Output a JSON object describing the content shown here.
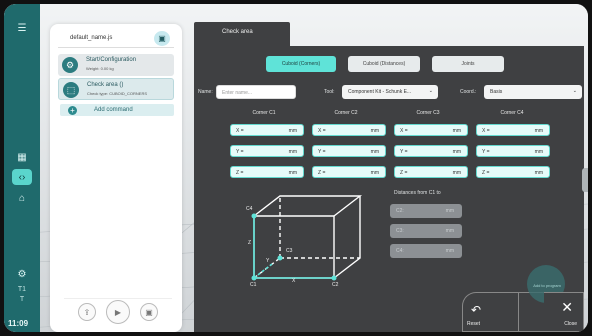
{
  "sidebar": {
    "time": "11:09",
    "small_labels": [
      "T1",
      "T"
    ]
  },
  "program": {
    "file_name": "default_name.js",
    "commands": [
      {
        "title": "Start/Configuration",
        "subtitle": "Weight: 0.00 kg"
      },
      {
        "title": "Check area ()",
        "subtitle": "Check type: CUBOID_CORNERS"
      }
    ],
    "add_command": "Add command"
  },
  "dialog": {
    "tab": "Check area",
    "segments": [
      "Cuboid (Corners)",
      "Cuboid (Distances)",
      "Joints"
    ],
    "name_label": "Name:",
    "name_placeholder": "Enter name...",
    "tool_label": "Tool:",
    "tool_value": "Component Kit - Schunk E...",
    "coord_label": "Coord.:",
    "coord_value": "Basis",
    "corners": [
      "Corner C1",
      "Corner C2",
      "Corner C3",
      "Corner C4"
    ],
    "axes": [
      "X =",
      "Y =",
      "Z ="
    ],
    "unit": "mm",
    "distances_title": "Distances from C1 to",
    "distances": [
      "C2:",
      "C3:",
      "C4:"
    ],
    "cube_labels": {
      "c1": "C1",
      "c2": "C2",
      "c3": "C3",
      "c4": "C4",
      "x": "X",
      "y": "Y",
      "z": "Z"
    },
    "add_to_program": "Add to program",
    "reset": "Reset",
    "close": "Close"
  },
  "colors": {
    "accent": "#5fe3d8",
    "sidebar": "#1f6a6c",
    "dialog": "#3f4042"
  }
}
